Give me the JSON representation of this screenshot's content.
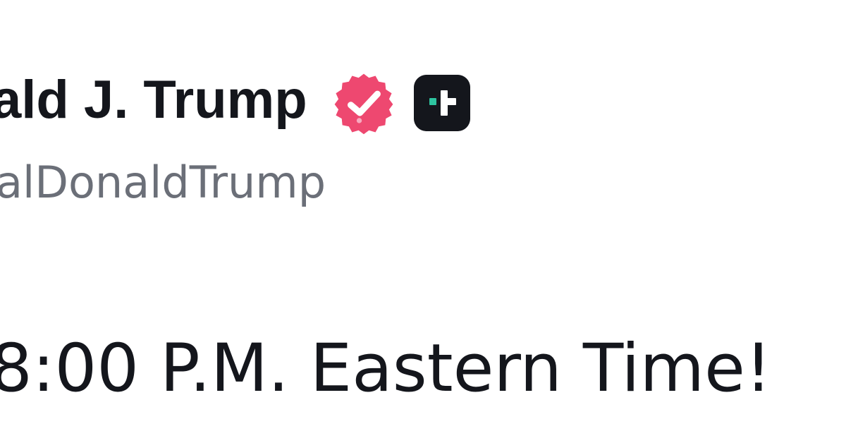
{
  "colors": {
    "text_primary": "#14161c",
    "text_secondary": "#6b6f78",
    "verified_badge": "#ee4870",
    "plus_badge_bg": "#14161c",
    "plus_badge_accent": "#2ec4a0"
  },
  "author": {
    "display_name": "ald J. Trump",
    "handle": "alDonaldTrump",
    "verified_icon": "verified-badge-icon",
    "plus_icon": "plus-member-icon"
  },
  "post": {
    "text": "8:00 P.M. Eastern Time!"
  }
}
